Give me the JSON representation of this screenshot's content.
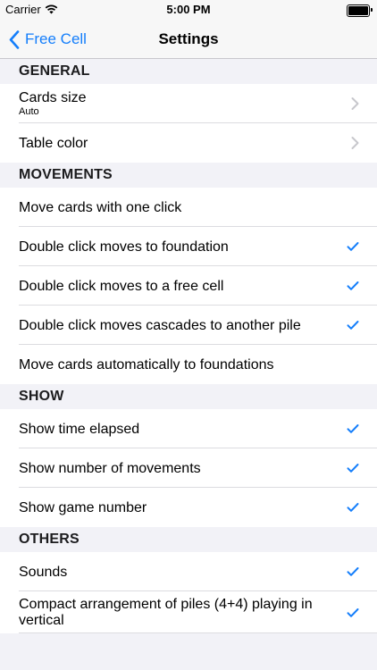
{
  "status_bar": {
    "carrier": "Carrier",
    "time": "5:00 PM"
  },
  "nav": {
    "back_label": "Free Cell",
    "title": "Settings"
  },
  "colors": {
    "accent": "#147efb",
    "chevron": "#c7c7cc"
  },
  "sections": {
    "general": {
      "header": "GENERAL",
      "cards_size": {
        "label": "Cards size",
        "value": "Auto"
      },
      "table_color": {
        "label": "Table color"
      }
    },
    "movements": {
      "header": "MOVEMENTS",
      "items": [
        {
          "label": "Move cards with one click",
          "checked": false
        },
        {
          "label": "Double click moves to foundation",
          "checked": true
        },
        {
          "label": "Double click moves to a free cell",
          "checked": true
        },
        {
          "label": "Double click moves cascades to another pile",
          "checked": true
        },
        {
          "label": "Move cards automatically to foundations",
          "checked": false
        }
      ]
    },
    "show": {
      "header": "SHOW",
      "items": [
        {
          "label": "Show time elapsed",
          "checked": true
        },
        {
          "label": "Show number of movements",
          "checked": true
        },
        {
          "label": "Show game number",
          "checked": true
        }
      ]
    },
    "others": {
      "header": "OTHERS",
      "items": [
        {
          "label": "Sounds",
          "checked": true
        },
        {
          "label": "Compact arrangement of piles (4+4) playing in vertical",
          "checked": true
        }
      ]
    }
  }
}
